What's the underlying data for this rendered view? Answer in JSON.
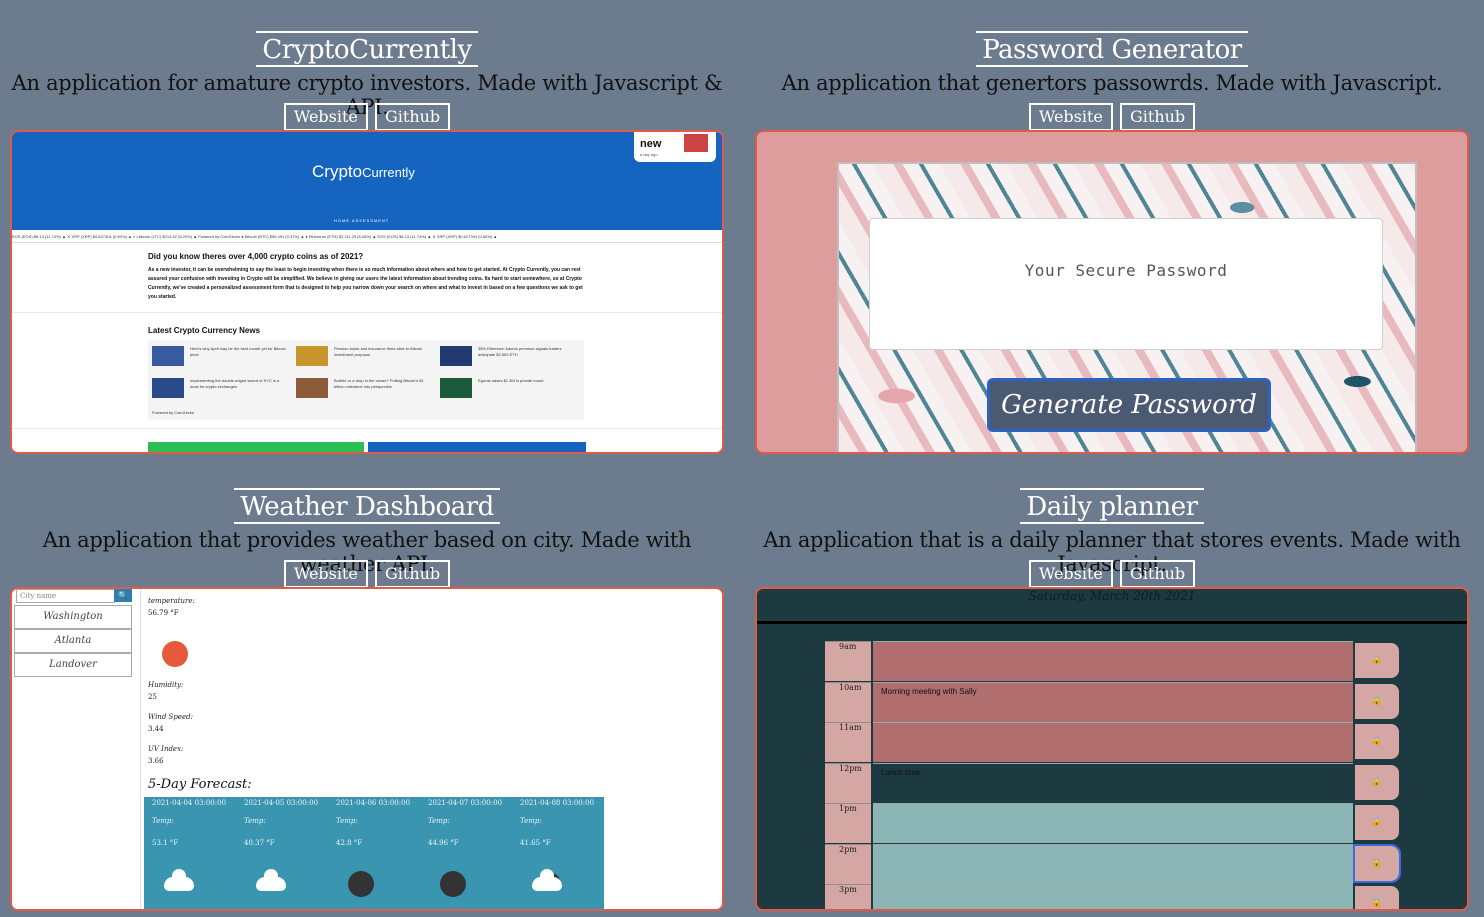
{
  "projects": [
    {
      "title": "CryptoCurrently",
      "description": "An application for amature crypto investors. Made with Javascript & API.",
      "website_label": "Website",
      "github_label": "Github"
    },
    {
      "title": "Password Generator",
      "description": "An application that genertors passowrds. Made with Javascript.",
      "website_label": "Website",
      "github_label": "Github"
    },
    {
      "title": "Weather Dashboard",
      "description": "An application that provides weather based on city. Made with weather API.",
      "website_label": "Website",
      "github_label": "Github"
    },
    {
      "title": "Daily planner",
      "description": "An application that is a daily planner that stores events. Made with Javascript.",
      "website_label": "Website",
      "github_label": "Github"
    }
  ],
  "crypto": {
    "brand": "Crypto",
    "brand_small": "Currently",
    "nav": "HOME    ASSESSMENT",
    "popup_title": "new",
    "popup_sub": "a day ago",
    "ticker": "EOS (EOS) $6.13 (11.74%) ▲  ✕ XRP (XRP) $0.627304 (0.60%) ▲  ◐ Litecoin (LTC) $214.52 (5.20%) ▲  Powered by CoinGecko  ● Bitcoin (BTC) $59,491 (0.37%) ▲  ♦ Ethereum (ETH) $2,111.25 (5.26%) ▲  EOS (EOS) $6.13 (11.74%) ▲  ✕ XRP (XRP) $0.627304 (0.60%) ▲",
    "question": "Did you know theres over 4,000 crypto coins as of 2021?",
    "paragraph": "As a new investor, it can be overwhelming to say the least to begin investing when there is so much information about where and how to get started. At Crypto Currently, you can rest assured your confusion with investing in Crypto will be simplified. We believe in giving our users the latest information about trending coins. Its hard to start somewhere, so at Crypto Currently, we've created a personalized assessment form that is designed to help you narrow down your search on where and what to invest in based on a few questions we ask to get you started.",
    "news_heading": "Latest Crypto Currency News",
    "news": [
      "Here's why April may be the best month yet for Bitcoin price",
      "Pension funds and insurance firms alive to Bitcoin investment proposal",
      "38% Ethereum futures premium signals traders anticipate $2,500 ETH",
      "Implementing the double-edged sword of KYC is a must for crypto exchanges",
      "Bubble or a drop in the ocean? Putting Bitcoin's $1 trillion milestone into perspective",
      "Egoras raises $1.3M in private round"
    ],
    "powered": "Powered by CoinGecko"
  },
  "password": {
    "placeholder": "Your Secure Password",
    "button": "Generate Password"
  },
  "weather": {
    "search_placeholder": "City name",
    "search_icon": "🔍",
    "cities": [
      "Washington",
      "Atlanta",
      "Landover"
    ],
    "temp_label": "temperature:",
    "temp_value": "56.79 °F",
    "humidity_label": "Humidity:",
    "humidity_value": "25",
    "wind_label": "Wind Speed:",
    "wind_value": "3.44",
    "uv_label": "UV Index:",
    "uv_value": "3.66",
    "forecast_heading": "5-Day Forecast:",
    "forecast": [
      {
        "date": "2021-04-04 03:00:00",
        "temp_label": "Temp:",
        "temp": "53.1 °F",
        "icon": "cloud"
      },
      {
        "date": "2021-04-05 03:00:00",
        "temp_label": "Temp:",
        "temp": "40.37 °F",
        "icon": "cloud"
      },
      {
        "date": "2021-04-06 03:00:00",
        "temp_label": "Temp:",
        "temp": "42.8 °F",
        "icon": "moon"
      },
      {
        "date": "2021-04-07 03:00:00",
        "temp_label": "Temp:",
        "temp": "44.96 °F",
        "icon": "moon"
      },
      {
        "date": "2021-04-08 03:00:00",
        "temp_label": "Temp:",
        "temp": "41.65 °F",
        "icon": "cloud-moon"
      }
    ]
  },
  "planner": {
    "date": "Saturday, March 20th 2021",
    "save_icon": "🔒",
    "rows": [
      {
        "hour": "9am",
        "text": "",
        "color": "#b06e6e"
      },
      {
        "hour": "10am",
        "text": "Morning meeting with Sally",
        "color": "#b06e6e"
      },
      {
        "hour": "11am",
        "text": "",
        "color": "#b06e6e"
      },
      {
        "hour": "12pm",
        "text": "Lunch time",
        "color": "#1c3a3f"
      },
      {
        "hour": "1pm",
        "text": "",
        "color": "#8cb5b5"
      },
      {
        "hour": "2pm",
        "text": "",
        "color": "#8cb5b5"
      },
      {
        "hour": "3pm",
        "text": "",
        "color": "#8cb5b5"
      }
    ]
  }
}
